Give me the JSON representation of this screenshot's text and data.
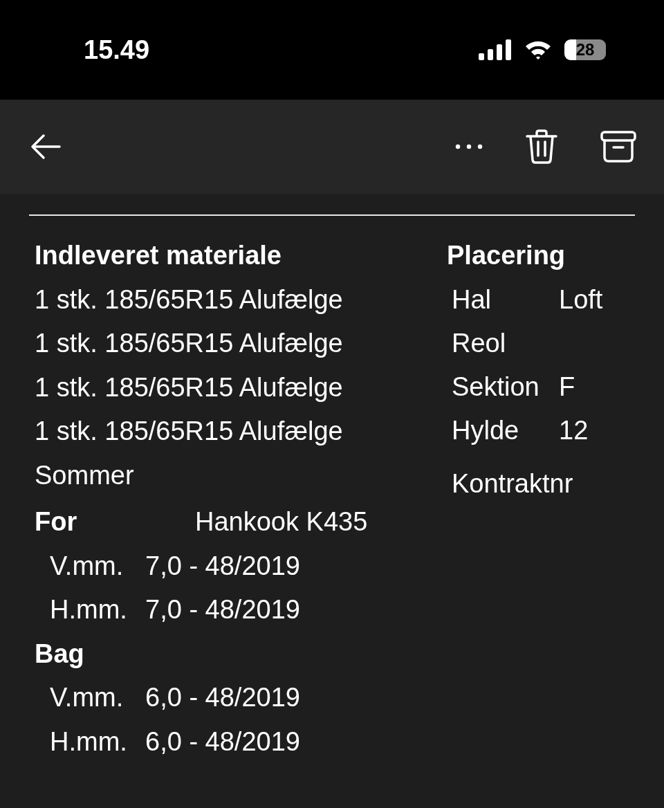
{
  "status_bar": {
    "time": "15.49",
    "battery": "28"
  },
  "delivered": {
    "heading": "Indleveret materiale",
    "items": [
      "1 stk. 185/65R15 Alufælge",
      "1 stk. 185/65R15 Alufælge",
      "1 stk. 185/65R15 Alufælge",
      "1 stk. 185/65R15 Alufælge"
    ],
    "season": "Sommer",
    "axles": [
      {
        "label": "For",
        "tire": "Hankook K435",
        "rows": [
          {
            "side": "V.mm.",
            "value": "7,0 - 48/2019"
          },
          {
            "side": "H.mm.",
            "value": "7,0 - 48/2019"
          }
        ]
      },
      {
        "label": "Bag",
        "rows": [
          {
            "side": "V.mm.",
            "value": "6,0 - 48/2019"
          },
          {
            "side": "H.mm.",
            "value": "6,0 - 48/2019"
          }
        ]
      }
    ]
  },
  "placement": {
    "heading": "Placering",
    "rows": [
      {
        "label": "Hal",
        "value": "Loft"
      },
      {
        "label": "Reol"
      },
      {
        "label": "Sektion",
        "value": "F"
      },
      {
        "label": "Hylde",
        "value": "12"
      },
      {
        "label": "Kontraktnr"
      }
    ]
  }
}
